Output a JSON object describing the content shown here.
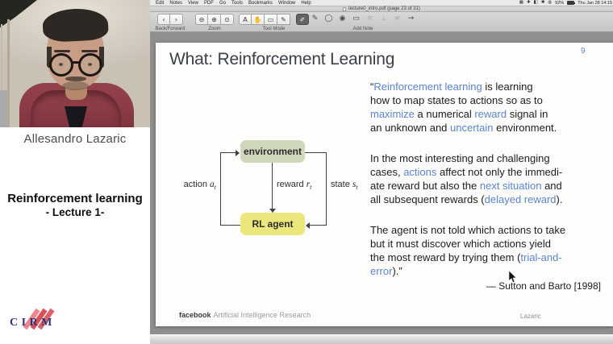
{
  "menu_bar": {
    "items": [
      "Edit",
      "Notes",
      "View",
      "PDF",
      "Go",
      "Tools",
      "Bookmarks",
      "Window",
      "Help"
    ],
    "status_icons": [
      "▦",
      "✚",
      "◧",
      "✱",
      "◍"
    ],
    "battery_pct": "92%",
    "clock": "Thu Jan 28 14:15"
  },
  "window": {
    "title": "lecture0_intro.pdf (page 23 of 31)",
    "toolbar": {
      "groups": [
        {
          "label": "Back/Forward",
          "buttons": [
            {
              "name": "back",
              "glyph": "‹"
            },
            {
              "name": "forward",
              "glyph": "›"
            }
          ]
        },
        {
          "label": "Zoom",
          "buttons": [
            {
              "name": "zoom-out",
              "glyph": "⊖"
            },
            {
              "name": "zoom-in",
              "glyph": "⊕"
            },
            {
              "name": "zoom-selection",
              "glyph": "⊙"
            }
          ]
        },
        {
          "label": "Tool Mode",
          "buttons": [
            {
              "name": "text-select",
              "glyph": "A"
            },
            {
              "name": "move",
              "glyph": "✋"
            },
            {
              "name": "select-rect",
              "glyph": "▭"
            },
            {
              "name": "annotate",
              "glyph": "✎"
            },
            {
              "name": "highlight",
              "glyph": "✐",
              "selected": 1
            }
          ]
        },
        {
          "label": "Add Note",
          "buttons": [
            {
              "name": "sketch",
              "glyph": "✎"
            },
            {
              "name": "oval",
              "glyph": "◯"
            },
            {
              "name": "note",
              "glyph": "◉"
            },
            {
              "name": "rectangle",
              "glyph": "▭"
            },
            {
              "name": "highlight-text",
              "glyph": "≡",
              "dim": 1
            },
            {
              "name": "underline-text",
              "glyph": "⊥",
              "dim": 1
            },
            {
              "name": "strikethrough-text",
              "glyph": "≠",
              "dim": 1
            },
            {
              "name": "arrow",
              "glyph": "→"
            }
          ]
        }
      ]
    }
  },
  "sidebar": {
    "speaker_name": "Allesandro Lazaric",
    "course_title": "Reinforcement learning",
    "lecture_subtitle": "- Lecture 1-",
    "logo_text": "CIRM"
  },
  "slide": {
    "title": "What:  Reinforcement Learning",
    "page_number": "9",
    "diagram": {
      "environment_label": "environment",
      "agent_label": "RL agent",
      "action": {
        "word": "action ",
        "var": "a",
        "sub": "t"
      },
      "reward": {
        "word": "reward ",
        "var": "r",
        "sub": "t"
      },
      "state": {
        "word": "state ",
        "var": "s",
        "sub": "t"
      }
    },
    "quote": {
      "paragraphs": [
        [
          [
            {
              "t": "“"
            },
            {
              "t": "Reinforcement learning",
              "b": 1
            },
            {
              "t": " is learning"
            }
          ],
          [
            {
              "t": "how to map states to actions so as to"
            }
          ],
          [
            {
              "t": "maximize",
              "b": 1
            },
            {
              "t": " a numerical "
            },
            {
              "t": "reward",
              "b": 1
            },
            {
              "t": " signal in"
            }
          ],
          [
            {
              "t": "an unknown and "
            },
            {
              "t": "uncertain",
              "b": 1
            },
            {
              "t": " environment."
            }
          ]
        ],
        [
          [
            {
              "t": "In the most interesting and challenging"
            }
          ],
          [
            {
              "t": "cases, "
            },
            {
              "t": "actions",
              "b": 1
            },
            {
              "t": " affect not only the immedi-"
            }
          ],
          [
            {
              "t": "ate reward but also the "
            },
            {
              "t": "next situation",
              "b": 1
            },
            {
              "t": " and"
            }
          ],
          [
            {
              "t": "all subsequent rewards ("
            },
            {
              "t": "delayed reward",
              "b": 1
            },
            {
              "t": ")."
            }
          ]
        ],
        [
          [
            {
              "t": "The agent is not told which actions to take"
            }
          ],
          [
            {
              "t": "but it must discover which actions yield"
            }
          ],
          [
            {
              "t": "the most reward by trying them ("
            },
            {
              "t": "trial-and-",
              "b": 1
            }
          ],
          [
            {
              "t": "error",
              "b": 1
            },
            {
              "t": ").”"
            }
          ]
        ]
      ]
    },
    "attribution": "— Sutton and Barto [1998]",
    "footer": {
      "brand": "facebook",
      "brand_rest": "Artificial Intelligence Research",
      "author": "Lazaric"
    }
  },
  "colors": {
    "accent_blue": "#5b85cc",
    "env_box": "#cfd8bc",
    "agent_box": "#ebe77d",
    "logo_navy": "#2f3174",
    "logo_red": "#d95059"
  }
}
